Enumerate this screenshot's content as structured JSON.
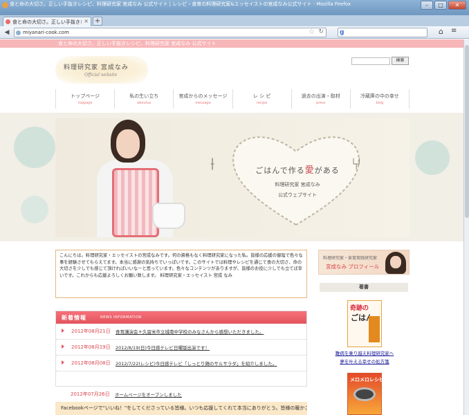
{
  "browser": {
    "window_title": "食と命の大切さ。正しい手抜きレシピ、料理研究家 宮成なみ 公式サイト | レシピ・食育の料理研究家&エッセイストの宮成なみ公式サイト - Mozilla Firefox",
    "tab_label": "食と命の大切さ。正しい手抜きレシピ...",
    "tab_close": "×",
    "new_tab": "+",
    "url": "miyanari-cook.com",
    "search_engine_glyph": "g",
    "min": "–",
    "max": "□",
    "close": "✕"
  },
  "site": {
    "tagline": "食と命の大切さ。正しい手抜きレシピ。料理研究家 宮成なみ 公式サイト",
    "logo_title": "料理研究家 宮成なみ",
    "logo_sub": "Official website",
    "search_button": "検索"
  },
  "nav": [
    {
      "jp": "トップページ",
      "en": "toppage"
    },
    {
      "jp": "私の生い立ち",
      "en": "aboutus"
    },
    {
      "jp": "宮成からのメッセージ",
      "en": "message"
    },
    {
      "jp": "レ シ ピ",
      "en": "recipe"
    },
    {
      "jp": "過去の出演・取材",
      "en": "press"
    },
    {
      "jp": "冷蔵庫の中の幸せ",
      "en": "blog"
    }
  ],
  "hero": {
    "catch_pre": "ごはんで作る",
    "catch_ai": "愛",
    "catch_post": "がある",
    "sub1": "料理研究家 宮成なみ",
    "sub2": "公式ウェブサイト"
  },
  "greeting": "こんにちは。料理研究家・エッセイストの宮成なみです。何の資格もなく料理研究家になった私。皆様の応援の御陰で色々な事を経験させてもらえてます。本当に感謝の気持ちでいっぱいです。このサイトでは料理やレシピを通じて食の大切さ、命の大切さを少しでも感じて頂ければいいなーと思っています。色々なコンテンツがありますが、皆様のお役に少しでも立てば幸いです。これからも応援よろしくお願い致します。 料理研究家・エッセイスト 宮成 なみ",
  "news": {
    "title_jp": "新着情報",
    "title_en": "NEWS INFORMATION",
    "items": [
      {
        "date": "2012年08月21日",
        "text": "食育講演会＊久留米市立城南中学校のみなさんから感想いただきました。"
      },
      {
        "date": "2012年08月19日",
        "text": "2012/8/19(日)今日感テレビ日曜版出演です！"
      },
      {
        "date": "2012年08月08日",
        "text": "2012/7/22(レシピ)今日感テレビ「しっとり鶏のサルサラダ」を紹介しました。"
      }
    ],
    "extra": {
      "date": "2012年07月26日",
      "text": "ホームページをオープンしました"
    }
  },
  "facebook_note": "Facebookページで\"いいね！\"をしてくださっている皆様。いつも応援してくれて本当にありがとう。皆様の暖かさ",
  "sidebar": {
    "profile_line1": "料理研究家・食育実践研究家",
    "profile_line2": "宮成なみ プロフィール",
    "books_heading": "著書",
    "book1_top": "奇跡の",
    "book1_mid": "ごはん",
    "book_caption": "難病を乗り越え料理研究家へ\n夢を叶える幸せの処方箋",
    "book2_title": "メロメロレシピ！"
  }
}
